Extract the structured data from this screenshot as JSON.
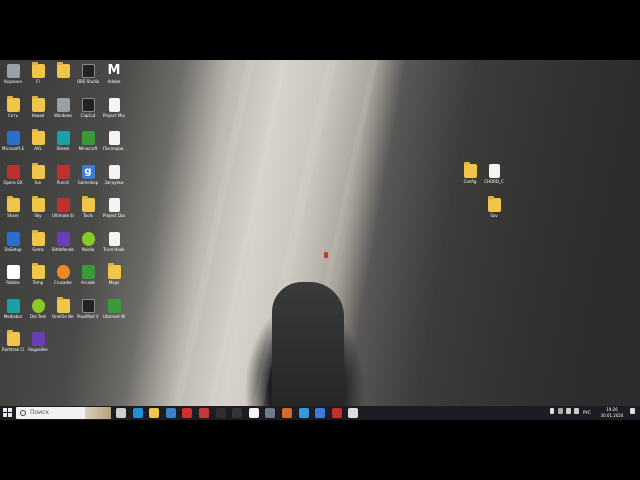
{
  "desktop_icons": [
    {
      "label": "Корзина",
      "kind": "gray"
    },
    {
      "label": "Fl",
      "kind": "folder"
    },
    {
      "label": "",
      "kind": "folder"
    },
    {
      "label": "OBS Studio",
      "kind": "dark"
    },
    {
      "label": "Adobe",
      "kind": "M"
    },
    {
      "label": "Сеть",
      "kind": "folder"
    },
    {
      "label": "Новая",
      "kind": "folder"
    },
    {
      "label": "Windows",
      "kind": "gray"
    },
    {
      "label": "CapCut",
      "kind": "dark"
    },
    {
      "label": "Project Music",
      "kind": "doc"
    },
    {
      "label": "Microsoft Edge",
      "kind": "app"
    },
    {
      "label": "AVL",
      "kind": "folder"
    },
    {
      "label": "Steam",
      "kind": "teal"
    },
    {
      "label": "Minecraft",
      "kind": "green"
    },
    {
      "label": "Последов...",
      "kind": "doc"
    },
    {
      "label": "Opera GX",
      "kind": "red"
    },
    {
      "label": "fun",
      "kind": "folder"
    },
    {
      "label": "Punch",
      "kind": "red"
    },
    {
      "label": "Gameloop",
      "kind": "blue-g"
    },
    {
      "label": "Загрузки",
      "kind": "doc"
    },
    {
      "label": "Share",
      "kind": "folder"
    },
    {
      "label": "Sky",
      "kind": "folder"
    },
    {
      "label": "Ultimate Edge",
      "kind": "red"
    },
    {
      "label": "Tools",
      "kind": "folder"
    },
    {
      "label": "Project Doc",
      "kind": "doc"
    },
    {
      "label": "DxSetup",
      "kind": "app"
    },
    {
      "label": "Gems",
      "kind": "folder"
    },
    {
      "label": "Bitdefender",
      "kind": "purple"
    },
    {
      "label": "Nvidia",
      "kind": "lime"
    },
    {
      "label": "Trust Hook",
      "kind": "doc"
    },
    {
      "label": "Roblox",
      "kind": "white"
    },
    {
      "label": "Temp",
      "kind": "folder"
    },
    {
      "label": "Crusader",
      "kind": "orange"
    },
    {
      "label": "Arcade",
      "kind": "green"
    },
    {
      "label": "Maps",
      "kind": "folder"
    },
    {
      "label": "Mediabar",
      "kind": "teal"
    },
    {
      "label": "Del Text",
      "kind": "lime"
    },
    {
      "label": "OneFile Net",
      "kind": "folder"
    },
    {
      "label": "PlusiMod V2",
      "kind": "dark"
    },
    {
      "label": "Utorrent Web",
      "kind": "green"
    },
    {
      "label": "Ramtrak Clip",
      "kind": "folder"
    },
    {
      "label": "Roguelike",
      "kind": "purple"
    }
  ],
  "right_icons": [
    {
      "label": "Config",
      "kind": "folder"
    },
    {
      "label": "CHORD_C",
      "kind": "doc"
    },
    {
      "label": "Sav",
      "kind": "folder"
    }
  ],
  "taskbar": {
    "search_placeholder": "Поиск",
    "apps": [
      {
        "name": "task-view-icon",
        "color": "#cfcfcf"
      },
      {
        "name": "edge-icon",
        "color": "#1f8fd6"
      },
      {
        "name": "explorer-icon",
        "color": "#f0c64a"
      },
      {
        "name": "store-icon",
        "color": "#3b82c4"
      },
      {
        "name": "opera-icon",
        "color": "#d23030"
      },
      {
        "name": "game-icon",
        "color": "#c23b3b"
      },
      {
        "name": "terminal-icon",
        "color": "#2e2e2e"
      },
      {
        "name": "media-icon",
        "color": "#333333"
      },
      {
        "name": "yandex-icon",
        "color": "#f5f5f5"
      },
      {
        "name": "pinned-app-icon",
        "color": "#6c7a89"
      },
      {
        "name": "folder-app-icon",
        "color": "#d46a2b"
      },
      {
        "name": "network-icon",
        "color": "#3a9ad9"
      },
      {
        "name": "gameloop-icon",
        "color": "#3e7bd6"
      },
      {
        "name": "record-icon",
        "color": "#c23030"
      },
      {
        "name": "window-icon",
        "color": "#dcdcdc"
      }
    ],
    "tray_lang": "РУС",
    "clock_time": "19:26",
    "clock_date": "30.01.2024"
  }
}
